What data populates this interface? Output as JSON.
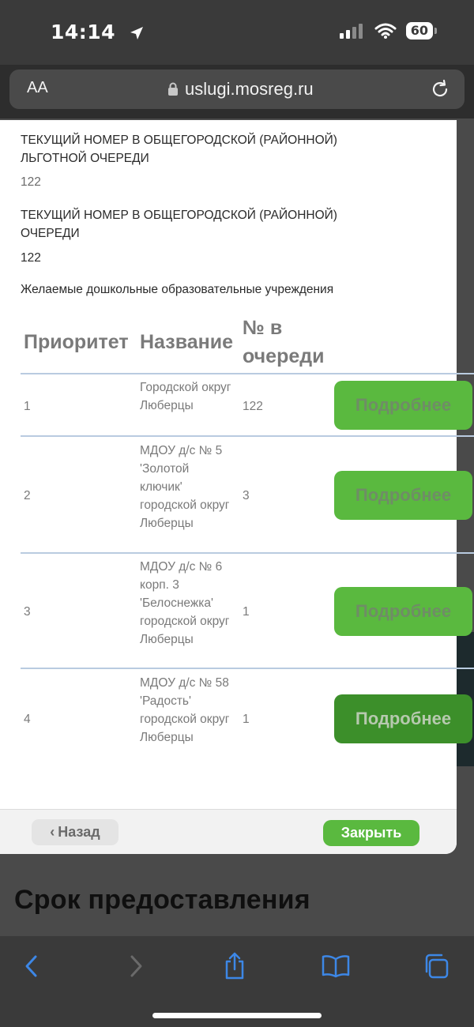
{
  "status_bar": {
    "time": "14:14",
    "battery": "60"
  },
  "browser": {
    "aa_label": "AA",
    "domain": "uslugi.mosreg.ru"
  },
  "modal": {
    "field1": {
      "label": "ТЕКУЩИЙ НОМЕР В ОБЩЕГОРОДСКОЙ (РАЙОННОЙ) ЛЬГОТНОЙ ОЧЕРЕДИ",
      "value": "122"
    },
    "field2": {
      "label": "ТЕКУЩИЙ НОМЕР В ОБЩЕГОРОДСКОЙ (РАЙОННОЙ) ОЧЕРЕДИ",
      "value": "122"
    },
    "section_title": "Желаемые дошкольные образовательные учреждения",
    "table": {
      "headers": {
        "priority": "Приоритет",
        "name": "Название",
        "queue_line1": "№ в",
        "queue_line2": "очереди"
      },
      "rows": [
        {
          "priority": "1",
          "name": "Городской округ Люберцы",
          "queue": "122",
          "action": "Подробнее"
        },
        {
          "priority": "2",
          "name": "МДОУ д/с № 5 'Золотой ключик' городской округ Люберцы",
          "queue": "3",
          "action": "Подробнее"
        },
        {
          "priority": "3",
          "name": "МДОУ д/с № 6 корп. 3 'Белоснежка' городской округ Люберцы",
          "queue": "1",
          "action": "Подробнее"
        },
        {
          "priority": "4",
          "name": "МДОУ д/с № 58 'Радость' городской округ Люберцы",
          "queue": "1",
          "action": "Подробнее"
        }
      ]
    },
    "footer": {
      "back_label": "Назад",
      "close_label": "Закрыть"
    }
  },
  "page": {
    "heading": "Срок предоставления"
  },
  "colors": {
    "accent_green": "#5ab93f",
    "pressed_green": "#3c8f2a",
    "row_divider": "#b9cbe0",
    "toolbar_blue": "#3d87e6"
  }
}
